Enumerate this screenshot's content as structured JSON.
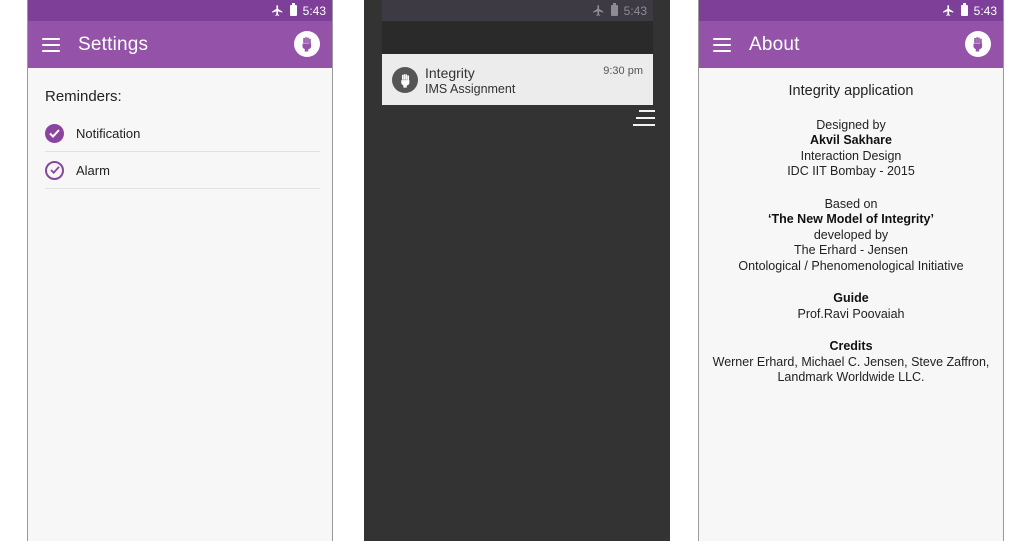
{
  "colors": {
    "status_bar": "#7d3f98",
    "app_bar": "#9452a8",
    "accent": "#8a44a0",
    "shade_bg": "#333333",
    "notification_bg": "#ececec"
  },
  "status_bar": {
    "time": "5:43",
    "icons": [
      "airplane-mode-icon",
      "battery-icon"
    ]
  },
  "settings_screen": {
    "title": "Settings",
    "section_title": "Reminders:",
    "items": [
      {
        "label": "Notification",
        "checked": true,
        "style": "filled"
      },
      {
        "label": "Alarm",
        "checked": true,
        "style": "outline"
      }
    ]
  },
  "notification_screen": {
    "status_time": "5:43",
    "notification": {
      "app_name": "Integrity",
      "text": "IMS Assignment",
      "time": "9:30 pm"
    }
  },
  "about_screen": {
    "title": "About",
    "heading": "Integrity application",
    "designed_by_label": "Designed by",
    "designer": "Akvil Sakhare",
    "discipline": "Interaction Design",
    "institute": "IDC IIT Bombay - 2015",
    "based_on_label": "Based on",
    "model_name": "‘The New Model of Integrity’",
    "developed_by_label": "developed by",
    "developers": "The Erhard - Jensen",
    "initiative": "Ontological / Phenomenological Initiative",
    "guide_label": "Guide",
    "guide_name": "Prof.Ravi Poovaiah",
    "credits_label": "Credits",
    "credits_line1": "Werner Erhard, Michael C. Jensen, Steve Zaffron,",
    "credits_line2": "Landmark Worldwide LLC."
  }
}
